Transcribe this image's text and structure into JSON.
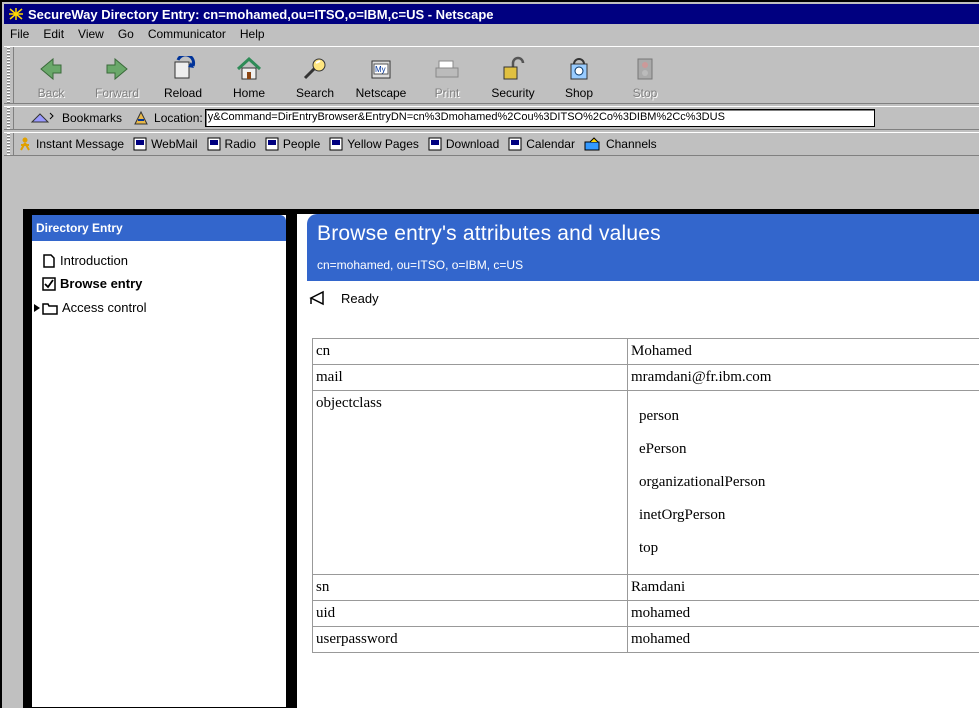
{
  "window": {
    "title": "SecureWay Directory Entry: cn=mohamed,ou=ITSO,o=IBM,c=US - Netscape"
  },
  "menubar": {
    "items": [
      "File",
      "Edit",
      "View",
      "Go",
      "Communicator",
      "Help"
    ]
  },
  "nav_toolbar": {
    "buttons": [
      {
        "label": "Back",
        "icon": "back-arrow-icon",
        "enabled": false
      },
      {
        "label": "Forward",
        "icon": "forward-arrow-icon",
        "enabled": false
      },
      {
        "label": "Reload",
        "icon": "reload-icon",
        "enabled": true
      },
      {
        "label": "Home",
        "icon": "home-icon",
        "enabled": true
      },
      {
        "label": "Search",
        "icon": "search-icon",
        "enabled": true
      },
      {
        "label": "Netscape",
        "icon": "netscape-icon",
        "enabled": true
      },
      {
        "label": "Print",
        "icon": "printer-icon",
        "enabled": false
      },
      {
        "label": "Security",
        "icon": "padlock-icon",
        "enabled": true
      },
      {
        "label": "Shop",
        "icon": "shop-icon",
        "enabled": true
      },
      {
        "label": "Stop",
        "icon": "stop-icon",
        "enabled": false
      }
    ]
  },
  "location_bar": {
    "bookmarks_label": "Bookmarks",
    "location_label": "Location:",
    "url": "y&Command=DirEntryBrowser&EntryDN=cn%3Dmohamed%2Cou%3DITSO%2Co%3DIBM%2Cc%3DUS"
  },
  "personal_bar": {
    "items": [
      "Instant Message",
      "WebMail",
      "Radio",
      "People",
      "Yellow Pages",
      "Download",
      "Calendar",
      "Channels"
    ]
  },
  "left_panel": {
    "header": "Directory Entry",
    "items": [
      {
        "label": "Introduction",
        "icon": "page-icon"
      },
      {
        "label": "Browse entry",
        "icon": "checked-page-icon"
      },
      {
        "label": "Access control",
        "icon": "folder-icon"
      }
    ]
  },
  "main": {
    "title": "Browse entry's attributes and values",
    "subtitle": "cn=mohamed, ou=ITSO, o=IBM, c=US",
    "status": "Ready",
    "attributes": [
      {
        "name": "cn",
        "values": [
          "Mohamed"
        ]
      },
      {
        "name": "mail",
        "values": [
          "mramdani@fr.ibm.com"
        ]
      },
      {
        "name": "objectclass",
        "values": [
          "person",
          "ePerson",
          "organizationalPerson",
          "inetOrgPerson",
          "top"
        ]
      },
      {
        "name": "sn",
        "values": [
          "Ramdani"
        ]
      },
      {
        "name": "uid",
        "values": [
          "mohamed"
        ]
      },
      {
        "name": "userpassword",
        "values": [
          "mohamed"
        ]
      }
    ]
  },
  "colors": {
    "title_bar": "#000080",
    "panel_header": "#3366cc",
    "chrome": "#c0c0c0"
  }
}
